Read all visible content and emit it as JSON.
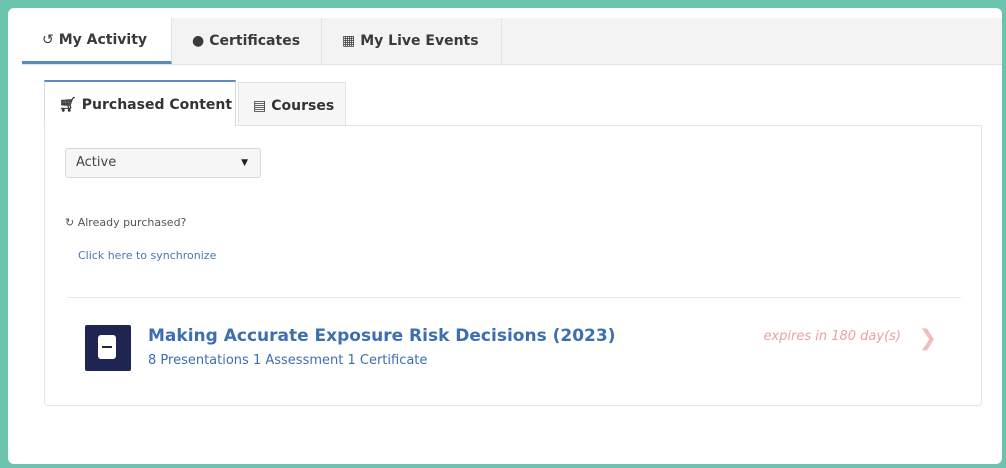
{
  "top_tabs": [
    {
      "label": "My Activity",
      "icon": "history-icon",
      "active": true
    },
    {
      "label": "Certificates",
      "icon": "badge-icon",
      "active": false
    },
    {
      "label": "My Live Events",
      "icon": "calendar-icon",
      "active": false
    }
  ],
  "sub_tabs": [
    {
      "label": "Purchased Content",
      "icon": "cart-icon",
      "active": true
    },
    {
      "label": "Courses",
      "icon": "book-icon",
      "active": false
    }
  ],
  "filter": {
    "selected": "Active"
  },
  "sync": {
    "label": "Already purchased?",
    "link": "Click here to synchronize"
  },
  "items": [
    {
      "title": "Making Accurate Exposure Risk Decisions (2023)",
      "meta": "8 Presentations 1 Assessment 1 Certificate",
      "expiry": "expires in 180 day(s)"
    }
  ],
  "colors": {
    "frame": "#6cc3ad",
    "accent": "#5b8cbf",
    "link": "#3d6fb0",
    "expiry": "#e8a2a2",
    "icon_bg": "#1f2550"
  }
}
